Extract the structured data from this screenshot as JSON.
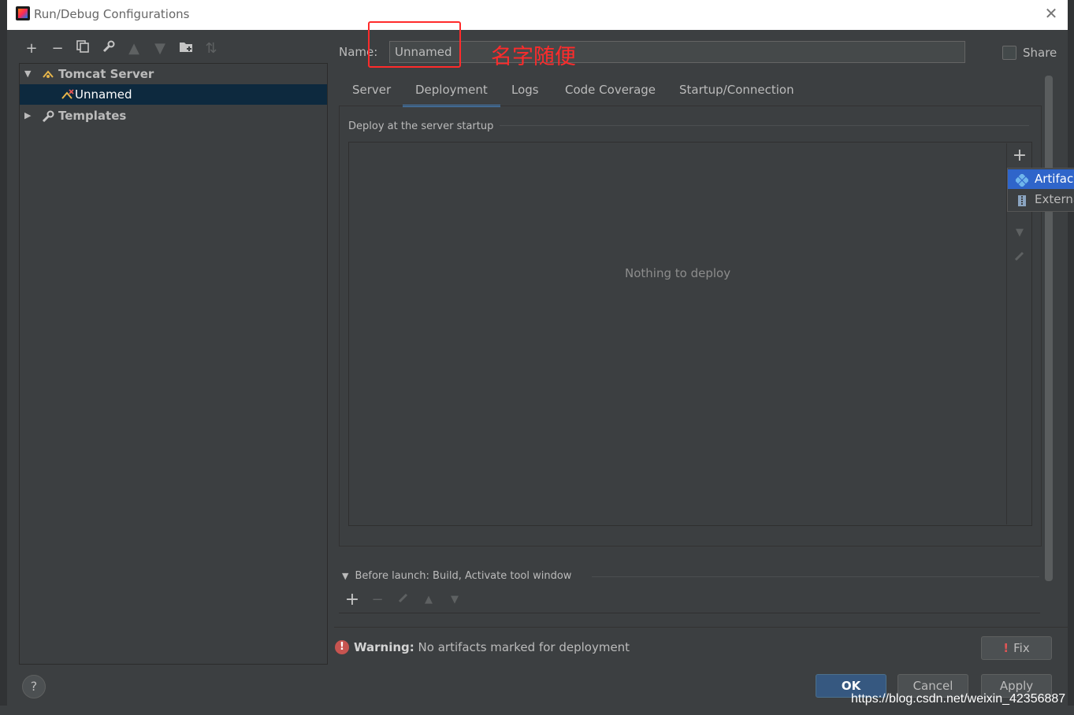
{
  "window": {
    "title": "Run/Debug Configurations"
  },
  "toolbar": {
    "icons": [
      "add-icon",
      "remove-icon",
      "copy-icon",
      "wrench-icon",
      "move-up-icon",
      "move-down-icon",
      "new-folder-icon",
      "sort-icon"
    ]
  },
  "tree": {
    "groups": [
      {
        "label": "Tomcat Server",
        "expanded": true,
        "children": [
          {
            "label": "Unnamed",
            "selected": true
          }
        ]
      },
      {
        "label": "Templates",
        "expanded": false
      }
    ]
  },
  "config": {
    "name_label": "Name:",
    "name_value": "Unnamed",
    "annotation": "名字随便",
    "share_label": "Share",
    "share_checked": false
  },
  "tabs": [
    {
      "label": "Server",
      "active": false
    },
    {
      "label": "Deployment",
      "active": true
    },
    {
      "label": "Logs",
      "active": false
    },
    {
      "label": "Code Coverage",
      "active": false
    },
    {
      "label": "Startup/Connection",
      "active": false
    }
  ],
  "deployment": {
    "group_title": "Deploy at the server startup",
    "empty_text": "Nothing to deploy",
    "add_menu": [
      {
        "label": "Artifac",
        "highlighted": true
      },
      {
        "label": "Externa",
        "highlighted": false
      }
    ]
  },
  "before_launch": {
    "title": "Before launch: Build, Activate tool window"
  },
  "status": {
    "warning_label": "Warning:",
    "warning_text": "No artifacts marked for deployment",
    "fix_label": "Fix"
  },
  "buttons": {
    "ok": "OK",
    "cancel": "Cancel",
    "apply": "Apply",
    "help": "?"
  },
  "watermark": "https://blog.csdn.net/weixin_42356887",
  "colors": {
    "accent": "#4a88c7",
    "annotation": "#ff2b2b",
    "selection": "#0d293e",
    "menu_highlight": "#2f65ca"
  }
}
